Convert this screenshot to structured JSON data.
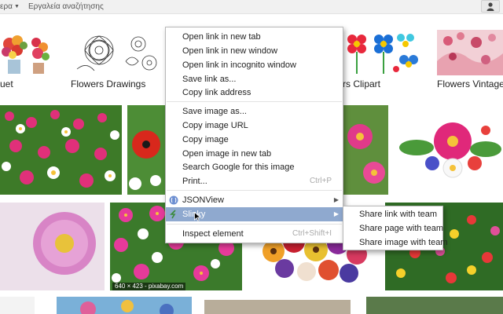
{
  "toolbar": {
    "more_label": "ερα",
    "search_tools_label": "Εργαλεία αναζήτησης",
    "user_icon": "person-icon"
  },
  "thumbnails": {
    "captions": {
      "bouquet": "uet",
      "drawings": "Flowers Drawings",
      "clipart": "rs Clipart",
      "vintage": "Flowers Vintage V"
    },
    "size_badge": "640 × 423 - pixabay.com"
  },
  "context_menu": {
    "items": [
      {
        "label": "Open link in new tab"
      },
      {
        "label": "Open link in new window"
      },
      {
        "label": "Open link in incognito window"
      },
      {
        "label": "Save link as..."
      },
      {
        "label": "Copy link address"
      },
      {
        "label": "Save image as..."
      },
      {
        "label": "Copy image URL"
      },
      {
        "label": "Copy image"
      },
      {
        "label": "Open image in new tab"
      },
      {
        "label": "Search Google for this image"
      },
      {
        "label": "Print...",
        "shortcut": "Ctrl+P"
      },
      {
        "label": "JSONView",
        "icon": "jsonview-icon",
        "submenu": true
      },
      {
        "label": "Slinky",
        "icon": "slinky-icon",
        "submenu": true,
        "highlighted": true
      },
      {
        "label": "Inspect element",
        "shortcut": "Ctrl+Shift+I"
      }
    ],
    "highlight_color": "#8fa9cf"
  },
  "submenu": {
    "items": [
      {
        "label": "Share link with team"
      },
      {
        "label": "Share page with team"
      },
      {
        "label": "Share image with team"
      }
    ]
  }
}
